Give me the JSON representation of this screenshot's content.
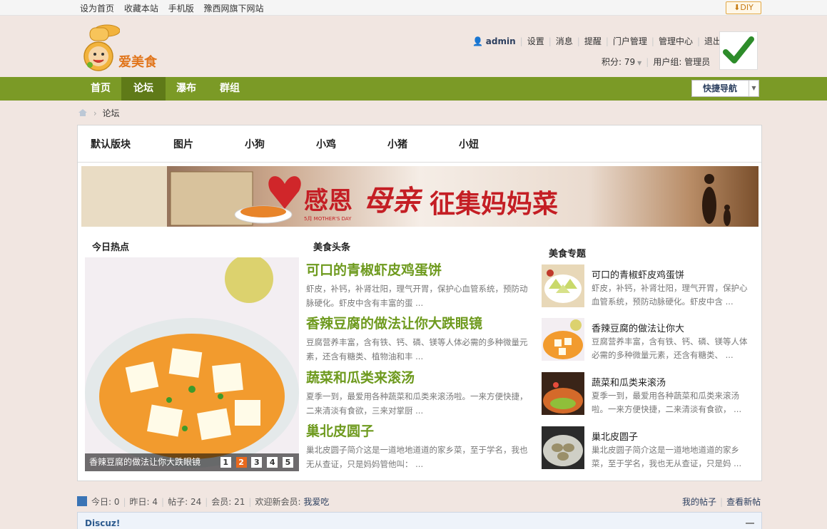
{
  "topbar": {
    "links": [
      "设为首页",
      "收藏本站",
      "手机版",
      "豫西网旗下网站"
    ],
    "diy_label": "DIY"
  },
  "logo": {
    "text": "爱美食"
  },
  "user": {
    "name": "admin",
    "links": [
      "设置",
      "消息",
      "提醒",
      "门户管理",
      "管理中心",
      "退出"
    ],
    "credits": "积分: 79",
    "group": "用户组: 管理员"
  },
  "nav": {
    "items": [
      "首页",
      "论坛",
      "瀑布",
      "群组"
    ],
    "active": "论坛",
    "quick_nav": "快捷导航"
  },
  "breadcrumb": {
    "current": "论坛"
  },
  "tabs": [
    "默认版块",
    "图片",
    "小狗",
    "小鸡",
    "小猪",
    "小妞"
  ],
  "banner": {
    "text1": "感恩",
    "text2": "母亲",
    "text3": "征集妈妈菜",
    "small": "5月 MOTHER'S DAY"
  },
  "hot": {
    "title": "今日热点",
    "caption": "香辣豆腐的做法让你大跌眼镜",
    "pages": [
      "1",
      "2",
      "3",
      "4",
      "5"
    ],
    "active_page": "2"
  },
  "headlines": {
    "title": "美食头条",
    "items": [
      {
        "title": "可口的青椒虾皮鸡蛋饼",
        "desc": "虾皮，补钙，补肾壮阳，理气开胃，保护心血管系统，预防动脉硬化。虾皮中含有丰富的蛋 ..."
      },
      {
        "title": "香辣豆腐的做法让你大跌眼镜",
        "desc": "豆腐营养丰富，含有铁、钙、磷、镁等人体必需的多种微量元素，还含有糖类、植物油和丰 ..."
      },
      {
        "title": "蔬菜和瓜类来滚汤",
        "desc": "夏季一到，最爱用各种蔬菜和瓜类来滚汤啦。一来方便快捷，二来清淡有食欲，三来对掌厨 ..."
      },
      {
        "title": "巢北皮圆子",
        "desc": "巢北皮圆子简介这是一道地地道道的家乡菜，至于学名，我也无从查证，只是妈妈管他叫： ..."
      }
    ]
  },
  "topics": {
    "title": "美食专题",
    "items": [
      {
        "title": "可口的青椒虾皮鸡蛋饼",
        "desc": "虾皮，补钙，补肾壮阳，理气开胃，保护心血管系统，预防动脉硬化。虾皮中含 ..."
      },
      {
        "title": "香辣豆腐的做法让你大",
        "desc": "豆腐营养丰富，含有铁、钙、磷、镁等人体必需的多种微量元素，还含有糖类、 ..."
      },
      {
        "title": "蔬菜和瓜类来滚汤",
        "desc": "夏季一到，最爱用各种蔬菜和瓜类来滚汤啦。一来方便快捷，二来清淡有食欲， ..."
      },
      {
        "title": "巢北皮圆子",
        "desc": "巢北皮圆子简介这是一道地地道道的家乡菜，至于学名，我也无从查证，只是妈 ..."
      }
    ]
  },
  "stats": {
    "today": "今日: 0",
    "yesterday": "昨日: 4",
    "posts": "帖子: 24",
    "members": "会员: 21",
    "welcome": "欢迎新会员:",
    "newest": "我爱吃",
    "my_posts": "我的帖子",
    "new_posts": "查看新帖"
  },
  "forum": {
    "name": "Discuz!"
  },
  "colors": {
    "nav": "#7b9a26",
    "accent_green": "#6e9a1e",
    "orange": "#e9691d"
  }
}
